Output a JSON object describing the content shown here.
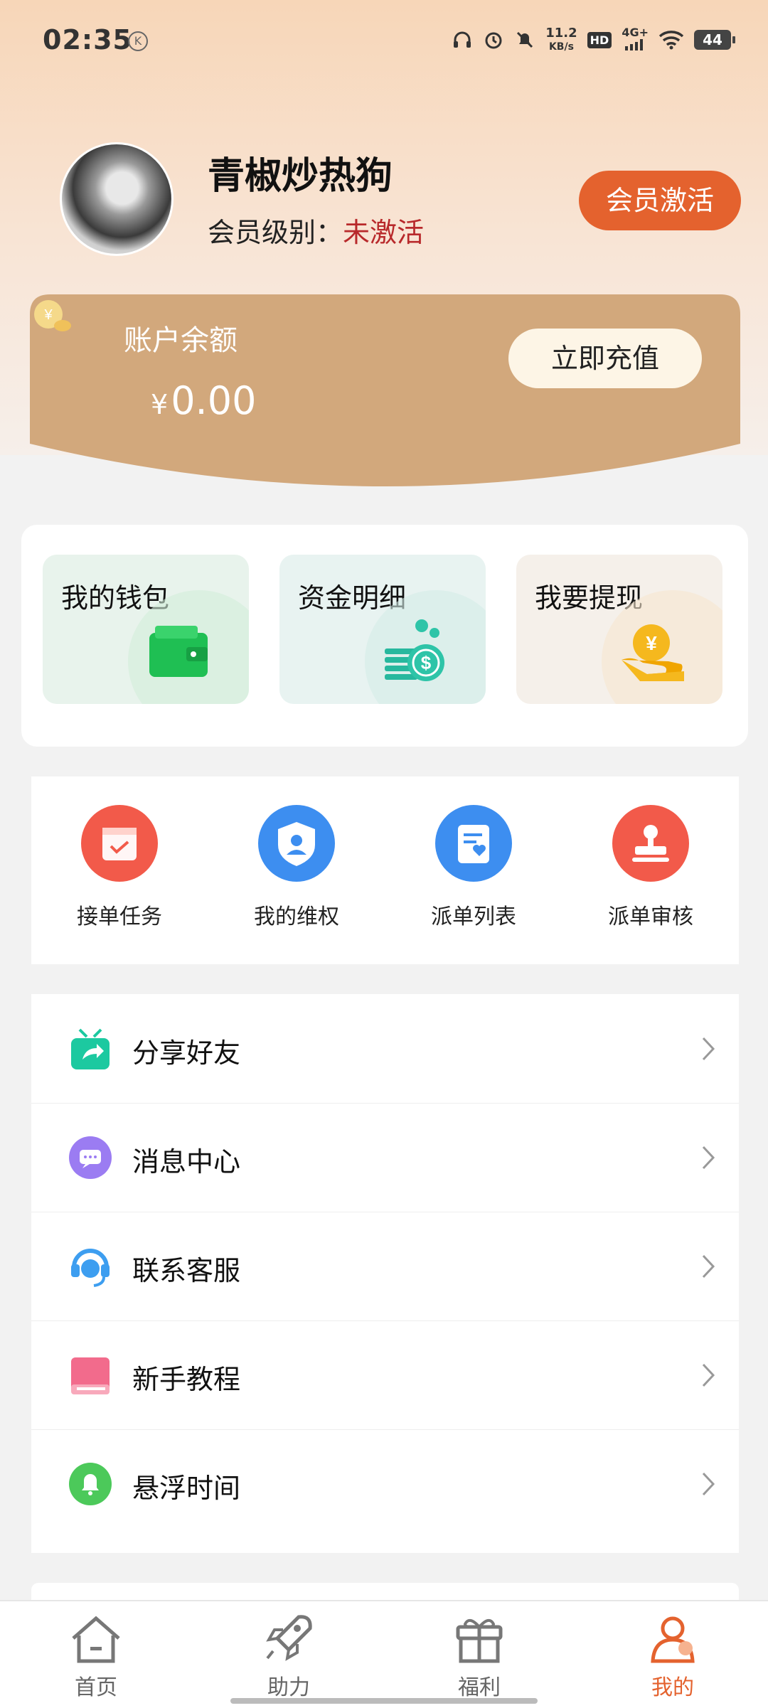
{
  "status": {
    "time": "02:35",
    "k_badge": "K",
    "net_speed_top": "11.2",
    "net_speed_unit": "KB/s",
    "hd": "HD",
    "net_type": "4G+",
    "battery": "44"
  },
  "profile": {
    "name": "青椒炒热狗",
    "level_label": "会员级别：",
    "level_value": "未激活",
    "member_button": "会员激活"
  },
  "balance": {
    "label": "账户余额",
    "currency": "¥",
    "amount": "0.00",
    "recharge_button": "立即充值"
  },
  "wallet_cards": [
    {
      "title": "我的钱包",
      "icon": "wallet-icon"
    },
    {
      "title": "资金明细",
      "icon": "coins-icon"
    },
    {
      "title": "我要提现",
      "icon": "withdraw-icon"
    }
  ],
  "quick_actions": [
    {
      "label": "接单任务",
      "icon": "calendar-check-icon",
      "color": "#f25a4a"
    },
    {
      "label": "我的维权",
      "icon": "shield-user-icon",
      "color": "#3d8ef0"
    },
    {
      "label": "派单列表",
      "icon": "document-heart-icon",
      "color": "#3d8ef0"
    },
    {
      "label": "派单审核",
      "icon": "stamp-icon",
      "color": "#f25a4a"
    }
  ],
  "menu": [
    {
      "label": "分享好友",
      "icon": "share-gift-icon",
      "color": "#1cc9a0"
    },
    {
      "label": "消息中心",
      "icon": "message-icon",
      "color": "#9b7cf2"
    },
    {
      "label": "联系客服",
      "icon": "headset-icon",
      "color": "#3d9ef0"
    },
    {
      "label": "新手教程",
      "icon": "book-icon",
      "color": "#f26b8c"
    },
    {
      "label": "悬浮时间",
      "icon": "bell-icon",
      "color": "#4cc95a"
    }
  ],
  "tabs": [
    {
      "label": "首页",
      "icon": "home-icon"
    },
    {
      "label": "助力",
      "icon": "rocket-icon"
    },
    {
      "label": "福利",
      "icon": "gift-icon"
    },
    {
      "label": "我的",
      "icon": "profile-icon",
      "active": true
    }
  ],
  "colors": {
    "accent": "#e4622e",
    "balance_card": "#d2a87c",
    "level_inactive": "#b8292b"
  }
}
